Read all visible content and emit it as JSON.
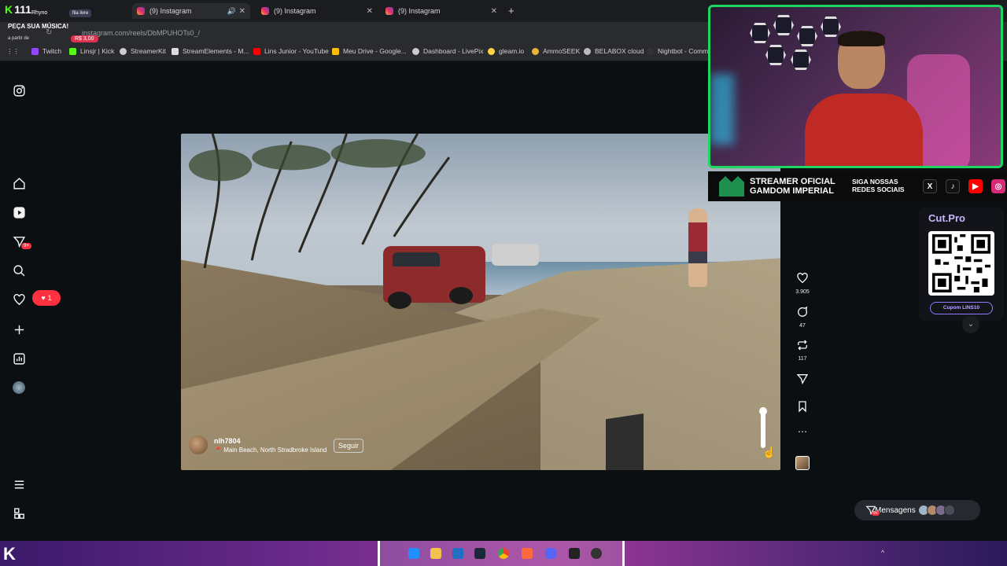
{
  "stream_overlay": {
    "viewer_count": "111",
    "streamer_name": "Rhyno",
    "queue_status": "fila livre",
    "request_title": "PEÇA SUA MÚSICA!",
    "request_from": "a partir de",
    "request_price": "R$ 3,00"
  },
  "browser": {
    "tabs": [
      {
        "title": "(9) Instagram",
        "active": true
      },
      {
        "title": "(9) Instagram",
        "active": false
      },
      {
        "title": "(9) Instagram",
        "active": false
      }
    ],
    "url": "instagram.com/reels/DbMPUHOTs0_/",
    "bookmarks": [
      {
        "label": "Twitch",
        "color": "#9146ff"
      },
      {
        "label": "Linsjr | Kick",
        "color": "#53fc18"
      },
      {
        "label": "StreamerKit",
        "color": "#cccccc"
      },
      {
        "label": "StreamElements - M...",
        "color": "#dddddd"
      },
      {
        "label": "Lins Junior - YouTube",
        "color": "#ff0000"
      },
      {
        "label": "Meu Drive - Google...",
        "color": "#fbbc04"
      },
      {
        "label": "Dashboard - LivePix",
        "color": "#cccccc"
      },
      {
        "label": "gleam.io",
        "color": "#ffd23f"
      },
      {
        "label": "AmmoSEEK",
        "color": "#e8b53a"
      },
      {
        "label": "BELABOX cloud",
        "color": "#bbbbbb"
      },
      {
        "label": "Nightbot - Comm...",
        "color": "#333333"
      }
    ]
  },
  "sidenav": {
    "items": [
      "instagram-icon",
      "home-icon",
      "reels-icon",
      "messages-icon",
      "search-icon",
      "notifications-icon",
      "create-icon",
      "dashboard-icon",
      "profile-avatar",
      "more-icon",
      "threads-icon"
    ],
    "messages_badge": "9+",
    "notifications_count": "1"
  },
  "reel": {
    "username": "nlh7804",
    "location": "Main Beach, North Stradbroke Island",
    "follow_label": "Seguir",
    "likes": "3.905",
    "comments": "47",
    "reposts": "117",
    "volume_level": 1.0
  },
  "webcam_banner": {
    "line1a": "STREAMER OFICIAL",
    "line1b": "GAMDOM IMPERIAL",
    "line2a": "SIGA NOSSAS",
    "line2b": "REDES SOCIAIS",
    "socials": [
      {
        "icon": "x-icon",
        "color": "#000000",
        "glyph": "X"
      },
      {
        "icon": "tiktok-icon",
        "color": "#111111",
        "glyph": "♪"
      },
      {
        "icon": "youtube-icon",
        "color": "#ff0000",
        "glyph": "▶"
      },
      {
        "icon": "instagram-icon",
        "color": "#d62976",
        "glyph": "◎"
      }
    ]
  },
  "sponsor": {
    "brand_a": "Cut.",
    "brand_b": "Pro",
    "coupon_label": "Cupom",
    "coupon_code": "LINS10"
  },
  "messages_bar": {
    "label": "Mensagens",
    "badge": "9+"
  }
}
